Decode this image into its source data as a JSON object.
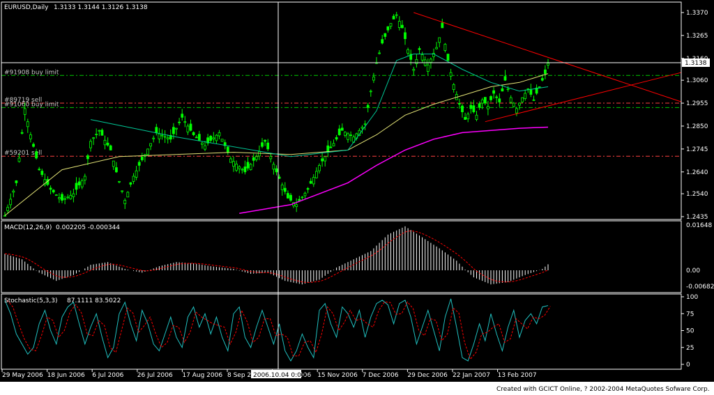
{
  "colors": {
    "background": "#000000",
    "frame": "#ffffff",
    "bull_bar": "#00ff00",
    "bear_bar": "#00ff00",
    "ma_fast": "#00c896",
    "ma_slow": "#e6e678",
    "ma_long": "#ff00ff",
    "trendline": "#ff0000",
    "buy_limit_line": "#00cc00",
    "sell_line": "#ff4040",
    "macd_hist": "#ffffff",
    "macd_signal": "#ff0000",
    "stoch_main": "#20c0c0",
    "stoch_signal": "#ff0000",
    "price_label_bg": "#ffffff",
    "footer_bg": "#ffffff"
  },
  "header": {
    "symbol": "EURUSD,Daily",
    "ohlc": "1.3133 1.3144 1.3126 1.3138"
  },
  "current_price_label": "1.3138",
  "crosshair_date_label": "2006.10.04 0:00",
  "orders": [
    {
      "label": "#91908 buy limit",
      "price": 1.3082,
      "kind": "buy"
    },
    {
      "label": "#89719 sell",
      "price": 1.2955,
      "kind": "sell"
    },
    {
      "label": "#91060 buy limit",
      "price": 1.2935,
      "kind": "buy"
    },
    {
      "label": "#59201 sell",
      "price": 1.2712,
      "kind": "sell"
    }
  ],
  "price_scale_labels": [
    "1.3370",
    "1.3265",
    "1.3160",
    "1.3060",
    "1.2955",
    "1.2850",
    "1.2745",
    "1.2640",
    "1.2540",
    "1.2435"
  ],
  "macd": {
    "label": "MACD(12,26,9)",
    "values": "0.002205 -0.000344",
    "scale_labels": [
      "0.01648",
      "0.00",
      "-0.00682"
    ]
  },
  "stochastic": {
    "label": "Stochastic(5,3,3)",
    "values": "87.1111 83.5022",
    "scale_labels": [
      "100",
      "75",
      "50",
      "25",
      "0"
    ]
  },
  "date_labels": [
    "29 May 2006",
    "18 Jun 2006",
    "6 Jul 2006",
    "26 Jul 2006",
    "17 Aug 2006",
    "8 Sep 20",
    "24 Oct 2006",
    "15 Nov 2006",
    "7 Dec 2006",
    "29 Dec 2006",
    "22 Jan 2007",
    "13 Feb 2007"
  ],
  "footer": "Created with GCICT Online, ? 2002-2004 MetaQuotes Sofware Corp.",
  "chart_data": {
    "type": "candlestick",
    "title": "EURUSD,Daily",
    "bars_approx": 191,
    "price_ylim": [
      1.2435,
      1.337
    ],
    "close_path": [
      [
        0,
        1.244
      ],
      [
        4,
        1.259
      ],
      [
        7,
        1.293
      ],
      [
        9,
        1.281
      ],
      [
        12,
        1.265
      ],
      [
        16,
        1.256
      ],
      [
        20,
        1.251
      ],
      [
        24,
        1.254
      ],
      [
        28,
        1.262
      ],
      [
        30,
        1.278
      ],
      [
        33,
        1.283
      ],
      [
        37,
        1.274
      ],
      [
        39,
        1.264
      ],
      [
        42,
        1.251
      ],
      [
        45,
        1.262
      ],
      [
        49,
        1.272
      ],
      [
        53,
        1.282
      ],
      [
        58,
        1.279
      ],
      [
        62,
        1.289
      ],
      [
        66,
        1.281
      ],
      [
        70,
        1.276
      ],
      [
        75,
        1.282
      ],
      [
        79,
        1.27
      ],
      [
        84,
        1.264
      ],
      [
        88,
        1.271
      ],
      [
        91,
        1.278
      ],
      [
        95,
        1.264
      ],
      [
        99,
        1.252
      ],
      [
        102,
        1.249
      ],
      [
        106,
        1.256
      ],
      [
        110,
        1.267
      ],
      [
        114,
        1.275
      ],
      [
        118,
        1.283
      ],
      [
        122,
        1.28
      ],
      [
        126,
        1.286
      ],
      [
        128,
        1.301
      ],
      [
        130,
        1.314
      ],
      [
        132,
        1.323
      ],
      [
        135,
        1.332
      ],
      [
        137,
        1.336
      ],
      [
        139,
        1.33
      ],
      [
        141,
        1.32
      ],
      [
        143,
        1.311
      ],
      [
        145,
        1.32
      ],
      [
        148,
        1.313
      ],
      [
        151,
        1.321
      ],
      [
        153,
        1.33
      ],
      [
        155,
        1.315
      ],
      [
        157,
        1.304
      ],
      [
        159,
        1.295
      ],
      [
        161,
        1.288
      ],
      [
        163,
        1.293
      ],
      [
        165,
        1.29
      ],
      [
        167,
        1.297
      ],
      [
        169,
        1.294
      ],
      [
        171,
        1.3
      ],
      [
        173,
        1.296
      ],
      [
        175,
        1.306
      ],
      [
        177,
        1.298
      ],
      [
        179,
        1.293
      ],
      [
        181,
        1.298
      ],
      [
        183,
        1.302
      ],
      [
        185,
        1.297
      ],
      [
        187,
        1.303
      ],
      [
        189,
        1.309
      ],
      [
        190,
        1.3138
      ]
    ],
    "ma_fast_path": [
      [
        30,
        1.288
      ],
      [
        60,
        1.28
      ],
      [
        100,
        1.271
      ],
      [
        120,
        1.274
      ],
      [
        130,
        1.292
      ],
      [
        137,
        1.315
      ],
      [
        143,
        1.318
      ],
      [
        150,
        1.318
      ],
      [
        160,
        1.311
      ],
      [
        170,
        1.305
      ],
      [
        180,
        1.301
      ],
      [
        190,
        1.303
      ]
    ],
    "ma_slow_path": [
      [
        0,
        1.244
      ],
      [
        20,
        1.265
      ],
      [
        40,
        1.271
      ],
      [
        60,
        1.272
      ],
      [
        80,
        1.273
      ],
      [
        100,
        1.272
      ],
      [
        120,
        1.274
      ],
      [
        130,
        1.281
      ],
      [
        140,
        1.29
      ],
      [
        150,
        1.295
      ],
      [
        160,
        1.299
      ],
      [
        170,
        1.303
      ],
      [
        180,
        1.305
      ],
      [
        190,
        1.309
      ]
    ],
    "ma_long_path": [
      [
        82,
        1.245
      ],
      [
        100,
        1.249
      ],
      [
        120,
        1.259
      ],
      [
        130,
        1.267
      ],
      [
        140,
        1.274
      ],
      [
        150,
        1.279
      ],
      [
        160,
        1.282
      ],
      [
        170,
        1.283
      ],
      [
        180,
        1.284
      ],
      [
        190,
        1.2845
      ]
    ],
    "trendlines": [
      {
        "from": [
          143,
          1.337
        ],
        "to": [
          238,
          1.2955
        ]
      },
      {
        "from": [
          168,
          1.287
        ],
        "to": [
          238,
          1.31
        ]
      }
    ],
    "macd_hist": [
      [
        0,
        0.006
      ],
      [
        6,
        0.004
      ],
      [
        12,
        -0.001
      ],
      [
        18,
        -0.0045
      ],
      [
        24,
        -0.002
      ],
      [
        30,
        0.002
      ],
      [
        36,
        0.003
      ],
      [
        42,
        0.0005
      ],
      [
        48,
        -0.001
      ],
      [
        54,
        0.0015
      ],
      [
        60,
        0.003
      ],
      [
        66,
        0.0025
      ],
      [
        72,
        0.0015
      ],
      [
        80,
        0.0005
      ],
      [
        86,
        -0.0015
      ],
      [
        92,
        -0.001
      ],
      [
        98,
        -0.0045
      ],
      [
        104,
        -0.006
      ],
      [
        110,
        -0.004
      ],
      [
        116,
        0.001
      ],
      [
        122,
        0.004
      ],
      [
        128,
        0.007
      ],
      [
        134,
        0.013
      ],
      [
        140,
        0.016
      ],
      [
        146,
        0.012
      ],
      [
        152,
        0.008
      ],
      [
        158,
        0.0035
      ],
      [
        164,
        -0.003
      ],
      [
        170,
        -0.006
      ],
      [
        176,
        -0.005
      ],
      [
        182,
        -0.002
      ],
      [
        188,
        0.0005
      ],
      [
        190,
        0.0022
      ]
    ],
    "macd_ylim": [
      -0.00682,
      0.01648
    ],
    "stoch_main": [
      [
        0,
        95
      ],
      [
        2,
        75
      ],
      [
        4,
        45
      ],
      [
        6,
        30
      ],
      [
        8,
        15
      ],
      [
        10,
        25
      ],
      [
        12,
        60
      ],
      [
        14,
        80
      ],
      [
        16,
        50
      ],
      [
        18,
        30
      ],
      [
        20,
        70
      ],
      [
        22,
        85
      ],
      [
        24,
        92
      ],
      [
        26,
        60
      ],
      [
        28,
        30
      ],
      [
        30,
        55
      ],
      [
        32,
        75
      ],
      [
        34,
        40
      ],
      [
        36,
        10
      ],
      [
        38,
        25
      ],
      [
        40,
        75
      ],
      [
        42,
        92
      ],
      [
        44,
        60
      ],
      [
        46,
        35
      ],
      [
        48,
        80
      ],
      [
        50,
        60
      ],
      [
        52,
        30
      ],
      [
        54,
        20
      ],
      [
        56,
        45
      ],
      [
        58,
        70
      ],
      [
        60,
        40
      ],
      [
        62,
        25
      ],
      [
        64,
        70
      ],
      [
        66,
        85
      ],
      [
        68,
        55
      ],
      [
        70,
        75
      ],
      [
        72,
        45
      ],
      [
        74,
        70
      ],
      [
        76,
        40
      ],
      [
        78,
        20
      ],
      [
        80,
        75
      ],
      [
        82,
        85
      ],
      [
        84,
        40
      ],
      [
        86,
        25
      ],
      [
        88,
        55
      ],
      [
        90,
        80
      ],
      [
        92,
        55
      ],
      [
        94,
        30
      ],
      [
        96,
        60
      ],
      [
        98,
        20
      ],
      [
        100,
        5
      ],
      [
        102,
        20
      ],
      [
        104,
        45
      ],
      [
        106,
        25
      ],
      [
        108,
        10
      ],
      [
        110,
        80
      ],
      [
        112,
        90
      ],
      [
        114,
        60
      ],
      [
        116,
        40
      ],
      [
        118,
        85
      ],
      [
        120,
        75
      ],
      [
        122,
        55
      ],
      [
        124,
        80
      ],
      [
        126,
        40
      ],
      [
        128,
        70
      ],
      [
        130,
        90
      ],
      [
        132,
        95
      ],
      [
        134,
        88
      ],
      [
        136,
        60
      ],
      [
        138,
        90
      ],
      [
        140,
        95
      ],
      [
        142,
        70
      ],
      [
        144,
        30
      ],
      [
        146,
        55
      ],
      [
        148,
        80
      ],
      [
        150,
        50
      ],
      [
        152,
        20
      ],
      [
        154,
        70
      ],
      [
        156,
        97
      ],
      [
        158,
        55
      ],
      [
        160,
        10
      ],
      [
        162,
        5
      ],
      [
        164,
        30
      ],
      [
        166,
        60
      ],
      [
        168,
        35
      ],
      [
        170,
        75
      ],
      [
        172,
        45
      ],
      [
        174,
        20
      ],
      [
        176,
        55
      ],
      [
        178,
        80
      ],
      [
        180,
        40
      ],
      [
        182,
        65
      ],
      [
        184,
        75
      ],
      [
        186,
        60
      ],
      [
        188,
        85
      ],
      [
        190,
        87
      ]
    ],
    "stoch_ylim": [
      0,
      100
    ]
  }
}
